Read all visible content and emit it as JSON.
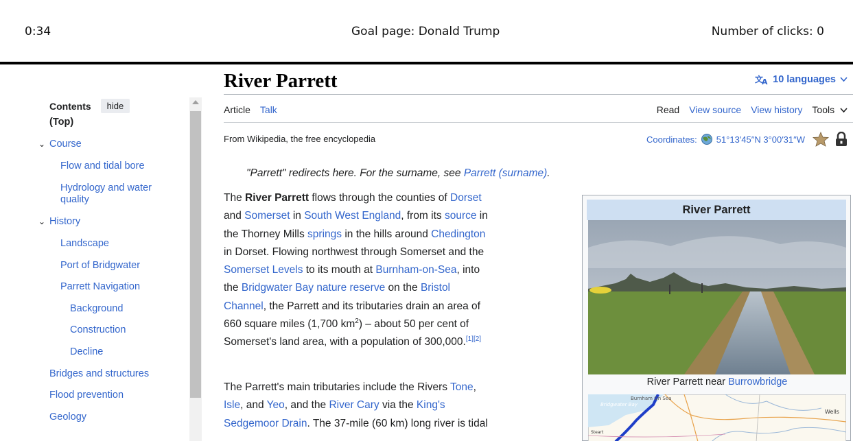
{
  "game": {
    "timer": "0:34",
    "goal": "Goal page: Donald Trump",
    "clicks": "Number of clicks: 0"
  },
  "toc": {
    "title": "Contents",
    "hide_label": "hide",
    "items": [
      {
        "label": "(Top)"
      },
      {
        "label": "Course",
        "chevron": "⌄"
      },
      {
        "label": "Flow and tidal bore"
      },
      {
        "label": "Hydrology and water"
      },
      {
        "label": "quality"
      },
      {
        "label": "History",
        "chevron": "⌄"
      },
      {
        "label": "Landscape"
      },
      {
        "label": "Port of Bridgwater"
      },
      {
        "label": "Parrett Navigation"
      },
      {
        "label": "Background"
      },
      {
        "label": "Construction"
      },
      {
        "label": "Decline"
      },
      {
        "label": "Bridges and structures"
      },
      {
        "label": "Flood prevention"
      },
      {
        "label": "Geology"
      }
    ]
  },
  "article": {
    "title": "River Parrett",
    "languages": "10 languages",
    "tabs": {
      "article": "Article",
      "talk": "Talk",
      "read": "Read",
      "view_source": "View source",
      "view_history": "View history",
      "tools": "Tools"
    },
    "from": "From Wikipedia, the free encyclopedia",
    "coordinates_label": "Coordinates:",
    "coordinates_value": "51°13′45″N 3°00′31″W",
    "hatnote_pre": "\"Parrett\" redirects here. For the surname, see ",
    "hatnote_link": "Parrett (surname)",
    "hatnote_post": ".",
    "p1": {
      "t1": "The ",
      "bold": "River Parrett",
      "t2": " flows through the counties of ",
      "l_dorset": "Dorset",
      "t3": "and ",
      "l_somerset": "Somerset",
      "t4": " in ",
      "l_swe": "South West England",
      "t5": ", from its ",
      "l_source": "source",
      "t6": " in",
      "t7": "the Thorney Mills ",
      "l_springs": "springs",
      "t8": " in the hills around ",
      "l_chedington": "Chedington",
      "t9": "in Dorset. Flowing northwest through Somerset and the",
      "l_levels": "Somerset Levels",
      "t10": " to its mouth at ",
      "l_burnham": "Burnham-on-Sea",
      "t11": ", into",
      "t12": "the ",
      "l_bay": "Bridgwater Bay nature reserve",
      "t13": " on the ",
      "l_bristol": "Bristol",
      "l_channel": "Channel",
      "t14": ", the Parrett and its tributaries drain an area of",
      "t15": "660 square miles (1,700 km",
      "sup2": "2",
      "t16": ") – about 50 per cent of",
      "t17": "Somerset's land area, with a population of 300,000.",
      "ref1": "[1]",
      "ref2": "[2]"
    },
    "p2": {
      "t1": "The Parrett's main tributaries include the Rivers ",
      "l_tone": "Tone",
      "t2": ",",
      "l_isle": "Isle",
      "t3": ", and ",
      "l_yeo": "Yeo",
      "t4": ", and the ",
      "l_cary": "River Cary",
      "t5": " via the ",
      "l_kings": "King's",
      "l_sedgemoor": "Sedgemoor Drain",
      "t6": ". The 37-mile (60 km) long river is tidal"
    }
  },
  "infobox": {
    "title": "River Parrett",
    "caption_pre": "River Parrett near ",
    "caption_link": "Burrowbridge",
    "map_labels": {
      "burnham": "Burnham On Sea",
      "bay": "Bridgwater Bay",
      "wells": "Wells",
      "other": "Steart"
    }
  },
  "colors": {
    "link": "#3366cc",
    "text": "#202122",
    "infobox_header": "#cedff2"
  }
}
